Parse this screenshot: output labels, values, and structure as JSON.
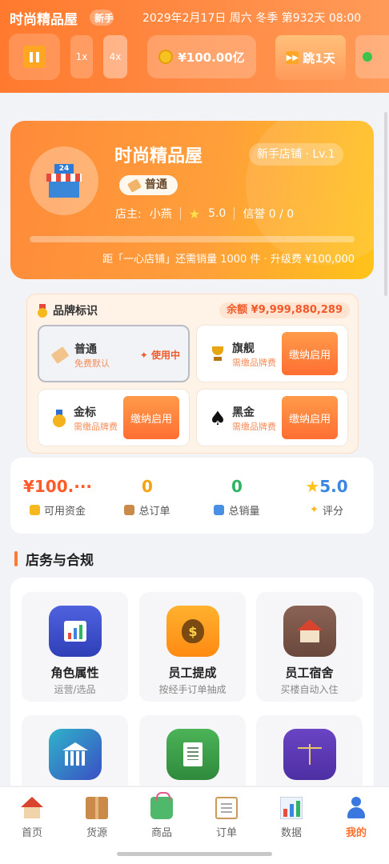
{
  "topbar": {
    "title": "时尚精品屋",
    "badge": "新手",
    "datetime": "2029年2月17日 周六 冬季 第932天 08:00",
    "speed_1x": "1x",
    "speed_4x": "4x",
    "funds": "¥100.00亿",
    "skip_label": "跳1天"
  },
  "shop": {
    "name": "时尚精品屋",
    "level_badge": "新手店铺 · Lv.1",
    "tag": "普通",
    "owner_label": "店主:",
    "owner_name": "小燕",
    "rating": "5.0",
    "credit": "信誉 0 / 0",
    "upgrade_note": "距「一心店铺」还需销量 1000 件 · 升级费 ¥100,000",
    "progress": 0
  },
  "brand": {
    "title": "品牌标识",
    "balance": "余额 ¥9,999,880,289",
    "options": [
      {
        "name": "普通",
        "sub": "免费默认",
        "status": "✦ 使用中"
      },
      {
        "name": "旗舰",
        "sub": "需缴品牌费",
        "button": "缴纳启用"
      },
      {
        "name": "金标",
        "sub": "需缴品牌费",
        "button": "缴纳启用"
      },
      {
        "name": "黑金",
        "sub": "需缴品牌费",
        "button": "缴纳启用"
      }
    ]
  },
  "stats": [
    {
      "value": "¥100.···",
      "label": "可用资金",
      "color": "#ff5a2a"
    },
    {
      "value": "0",
      "label": "总订单",
      "color": "#f3a311"
    },
    {
      "value": "0",
      "label": "总销量",
      "color": "#2fb463"
    },
    {
      "value": "5.0",
      "label": "评分",
      "color": "#3a86e0"
    }
  ],
  "section": {
    "title": "店务与合规"
  },
  "tiles": [
    {
      "title": "角色属性",
      "sub": "运营/选品",
      "color": "#3f56d0"
    },
    {
      "title": "员工提成",
      "sub": "按经手订单抽成",
      "color": "#ff9b1e"
    },
    {
      "title": "员工宿舍",
      "sub": "买楼自动入住",
      "color": "#7a5548"
    },
    {
      "title": "",
      "sub": "",
      "color": "#2a6fc0"
    },
    {
      "title": "",
      "sub": "",
      "color": "#3b9b4a"
    },
    {
      "title": "",
      "sub": "",
      "color": "#5a3ab0"
    }
  ],
  "nav": [
    {
      "label": "首页"
    },
    {
      "label": "货源"
    },
    {
      "label": "商品"
    },
    {
      "label": "订单"
    },
    {
      "label": "数据"
    },
    {
      "label": "我的"
    }
  ]
}
